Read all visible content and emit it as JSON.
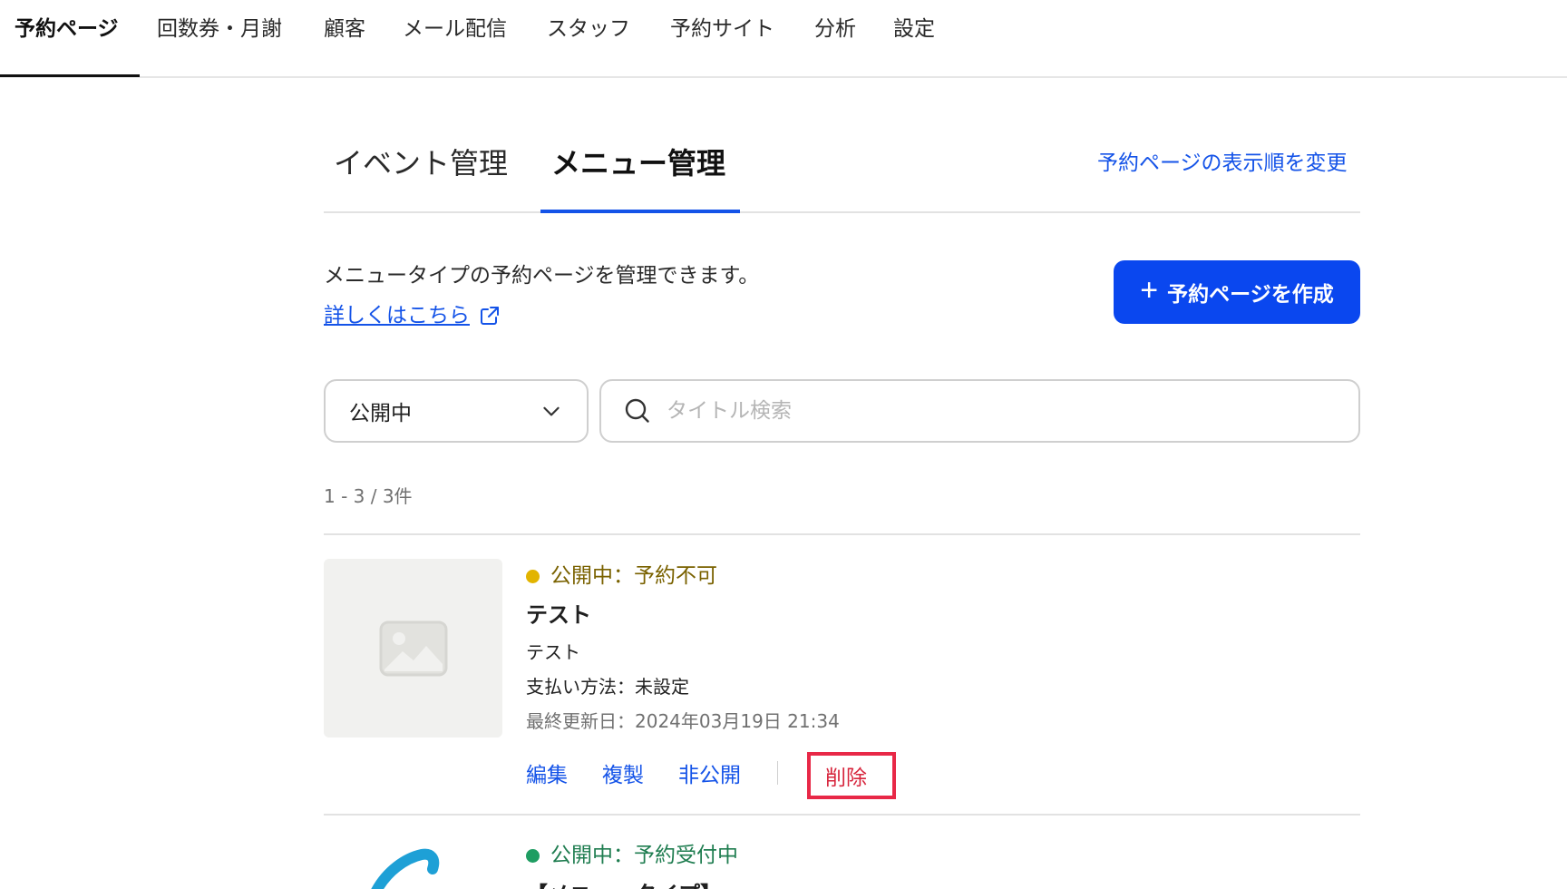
{
  "topnav": {
    "items": [
      "予約ページ",
      "回数券・月謝",
      "顧客",
      "メール配信",
      "スタッフ",
      "予約サイト",
      "分析",
      "設定"
    ]
  },
  "tabs": {
    "event": "イベント管理",
    "menu": "メニュー管理",
    "active": "メニュー管理"
  },
  "reorder_link": "予約ページの表示順を変更",
  "description": "メニュータイプの予約ページを管理できます。",
  "more_link": "詳しくはこちら",
  "create_button": "予約ページを作成",
  "filter": {
    "selected": "公開中",
    "search_placeholder": "タイトル検索"
  },
  "count": "1 - 3 / 3件",
  "items": [
    {
      "status": "公開中：予約不可",
      "status_color": "#e2b400",
      "status_text_color": "#7a6200",
      "title": "テスト",
      "description": "テスト",
      "payment": "支払い方法：未設定",
      "updated": "最終更新日：2024年03月19日 21:34",
      "actions": {
        "edit": "編集",
        "duplicate": "複製",
        "unpublish": "非公開",
        "delete": "削除"
      }
    },
    {
      "status": "公開中：予約受付中",
      "status_color": "#1f9d62",
      "status_text_color": "#1f7d50",
      "title": "【メニュータイプ】"
    }
  ],
  "colors": {
    "accent": "#0a47ef",
    "link": "#1453e8",
    "delete": "#e82847"
  }
}
